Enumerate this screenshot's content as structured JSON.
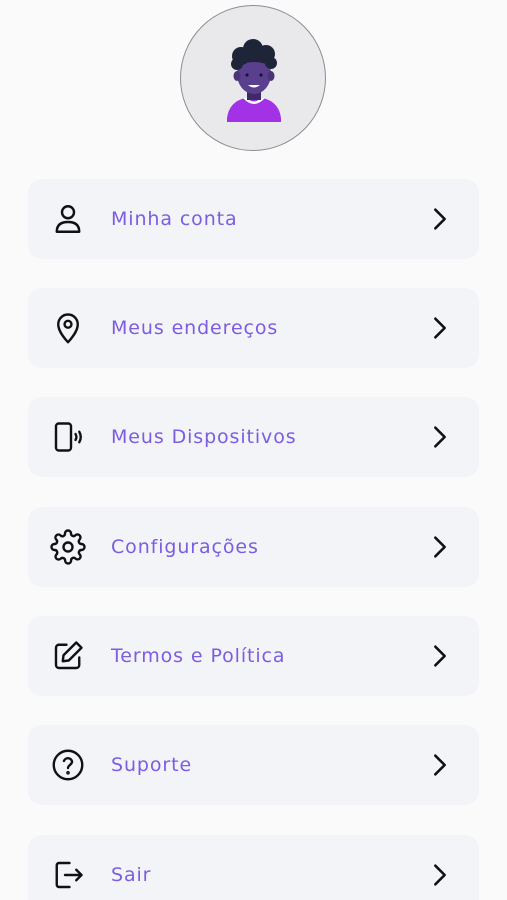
{
  "profile": {
    "avatar_icon": "user-avatar-illustration"
  },
  "menu": {
    "items": [
      {
        "id": "account",
        "label": "Minha conta",
        "icon": "user-icon"
      },
      {
        "id": "addresses",
        "label": "Meus endereços",
        "icon": "location-pin-icon"
      },
      {
        "id": "devices",
        "label": "Meus Dispositivos",
        "icon": "phone-vibrate-icon"
      },
      {
        "id": "settings",
        "label": "Configurações",
        "icon": "gear-icon"
      },
      {
        "id": "terms",
        "label": "Termos e Política",
        "icon": "edit-icon"
      },
      {
        "id": "support",
        "label": "Suporte",
        "icon": "help-circle-icon"
      },
      {
        "id": "logout",
        "label": "Sair",
        "icon": "logout-icon"
      }
    ],
    "chevron_icon": "chevron-right-icon"
  },
  "colors": {
    "label": "#7c5ce0",
    "item_background": "#f3f4f8",
    "page_background": "#fafafb",
    "avatar_shirt": "#9b30e0"
  }
}
